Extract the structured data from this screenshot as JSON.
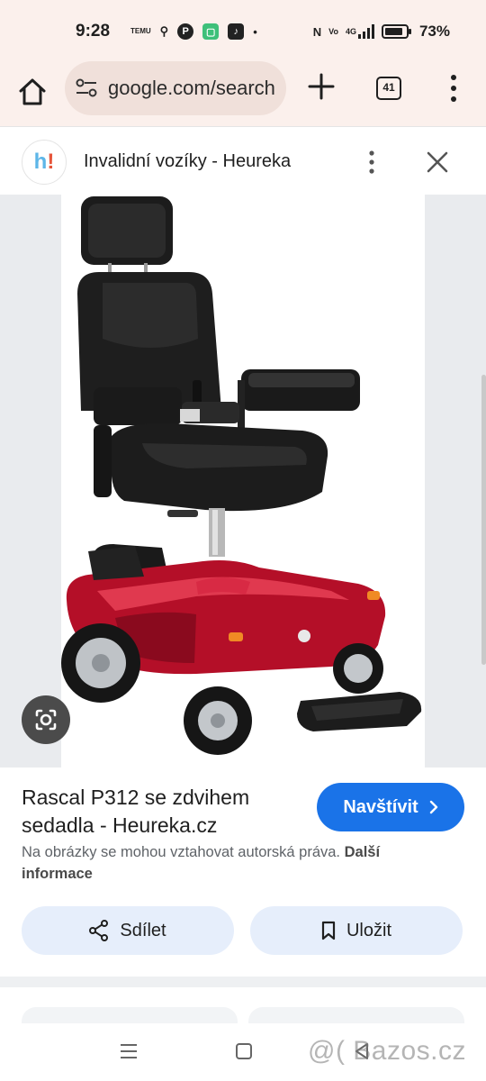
{
  "status_bar": {
    "time": "9:28",
    "left_icons": [
      "temu-icon",
      "location-icon",
      "pinterest-icon",
      "app-icon",
      "tiktok-icon",
      "dot-icon"
    ],
    "left_icon_glyphs": [
      "TEMU",
      "⚲",
      "P",
      "▢",
      "♪",
      "•"
    ],
    "right_icons": [
      "nfc-icon",
      "volte-icon",
      "signal-4g-icon",
      "battery-icon"
    ],
    "right_icon_glyphs": [
      "N",
      "Vo",
      "4G",
      ""
    ],
    "battery": "73%"
  },
  "toolbar": {
    "url": "google.com/search",
    "tab_count": "41"
  },
  "source": {
    "favicon_h": "h",
    "favicon_ex": "!",
    "title": "Invalidní vozíky - Heureka"
  },
  "image": {
    "subject": "Red power wheelchair with black leather seat"
  },
  "result": {
    "title": "Rascal P312 se zdvihem sedadla - Heureka.cz",
    "visit_label": "Navštívit",
    "copyright_text": "Na obrázky se mohou vztahovat autorská práva.",
    "copyright_link": "Další informace",
    "share_label": "Sdílet",
    "save_label": "Uložit"
  },
  "watermark": "@( Bazos.cz",
  "colors": {
    "accent": "#1a73e8",
    "chrome_bg": "#fbf0ec",
    "action_bg": "#e6eefb",
    "wheelchair_red": "#c8102e"
  }
}
